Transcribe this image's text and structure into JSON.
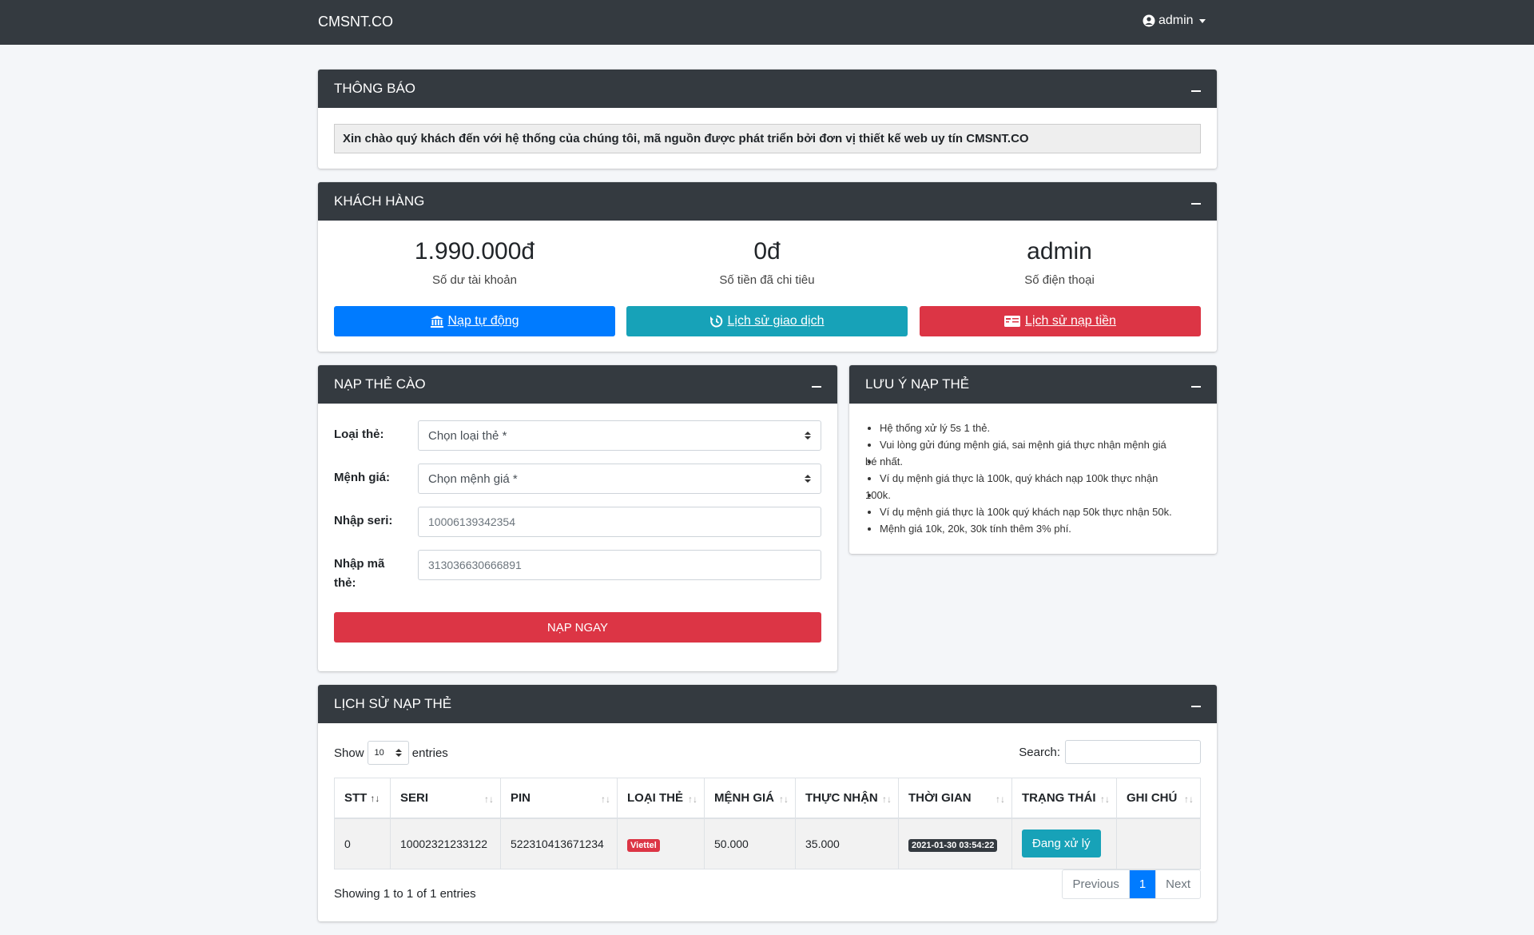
{
  "topbar": {
    "brand": "CMSNT.CO",
    "user": "admin"
  },
  "notice": {
    "title": "THÔNG BÁO",
    "message": "Xin chào quý khách đến với hệ thống của chúng tôi, mã nguồn được phát triển bởi đơn vị thiết kế web uy tín CMSNT.CO"
  },
  "customer": {
    "title": "KHÁCH HÀNG",
    "stats": [
      {
        "value": "1.990.000đ",
        "label": "Số dư tài khoản"
      },
      {
        "value": "0đ",
        "label": "Số tiền đã chi tiêu"
      },
      {
        "value": "admin",
        "label": "Số điện thoại"
      }
    ],
    "buttons": {
      "auto_topup": "Nạp tự động",
      "transactions": "Lịch sử giao dịch",
      "topup_history": "Lịch sử nạp tiền"
    }
  },
  "card_form": {
    "title": "NẠP THẺ CÀO",
    "type_label": "Loại thẻ:",
    "type_value": "Chọn loại thẻ *",
    "amount_label": "Mệnh giá:",
    "amount_value": "Chọn mệnh giá *",
    "serial_label": "Nhập seri:",
    "serial_placeholder": "10006139342354",
    "code_label_1": "Nhập mã",
    "code_label_2": "thẻ:",
    "code_placeholder": "313036630666891",
    "submit": "NẠP NGAY"
  },
  "notes": {
    "title": "LƯU Ý NẠP THẺ",
    "l1": "Hệ thống xử lý 5s 1 thẻ.",
    "l2a": "Vui lòng gửi đúng mệnh giá, sai mệnh giá thực nhận mệnh giá",
    "l2b": "bé nhất.",
    "l3a": "Ví dụ mệnh giá thực là 100k, quý khách nạp 100k thực nhận",
    "l3b": "100k.",
    "l4": "Ví dụ mệnh giá thực là 100k quý khách nạp 50k thực nhận 50k.",
    "l5": "Mệnh giá 10k, 20k, 30k tính thêm 3% phí."
  },
  "history": {
    "title": "LỊCH SỬ NẠP THẺ",
    "show": "Show",
    "entries_value": "10",
    "entries": "entries",
    "search": "Search:",
    "headers": [
      "STT",
      "SERI",
      "PIN",
      "LOẠI THẺ",
      "MỆNH GIÁ",
      "THỰC NHẬN",
      "THỜI GIAN",
      "TRẠNG THÁI",
      "GHI CHÚ"
    ],
    "row": {
      "stt": "0",
      "seri": "10002321233122",
      "pin": "522310413671234",
      "type": "Viettel",
      "amount": "50.000",
      "received": "35.000",
      "time": "2021-01-30 03:54:22",
      "status": "Đang xử lý",
      "note": ""
    },
    "info": "Showing 1 to 1 of 1 entries",
    "prev": "Previous",
    "page": "1",
    "next": "Next"
  }
}
